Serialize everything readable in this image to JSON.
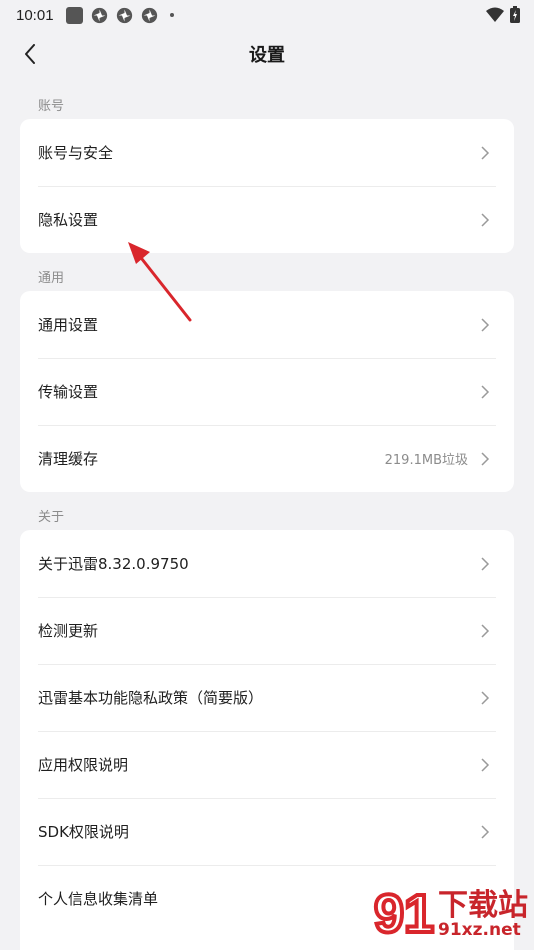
{
  "status_bar": {
    "time": "10:01"
  },
  "header": {
    "title": "设置"
  },
  "sections": [
    {
      "label": "账号",
      "items": [
        {
          "label": "账号与安全"
        },
        {
          "label": "隐私设置"
        }
      ]
    },
    {
      "label": "通用",
      "items": [
        {
          "label": "通用设置"
        },
        {
          "label": "传输设置"
        },
        {
          "label": "清理缓存",
          "value": "219.1MB垃圾"
        }
      ]
    },
    {
      "label": "关于",
      "items": [
        {
          "label": "关于迅雷8.32.0.9750"
        },
        {
          "label": "检测更新"
        },
        {
          "label": "迅雷基本功能隐私政策（简要版）"
        },
        {
          "label": "应用权限说明"
        },
        {
          "label": "SDK权限说明"
        },
        {
          "label": "个人信息收集清单"
        }
      ]
    }
  ],
  "watermark": {
    "brand": "下载站",
    "domain": "91xz.net",
    "logo_mark": "91"
  },
  "colors": {
    "accent_red": "#d9262c",
    "background": "#f2f2f4"
  }
}
